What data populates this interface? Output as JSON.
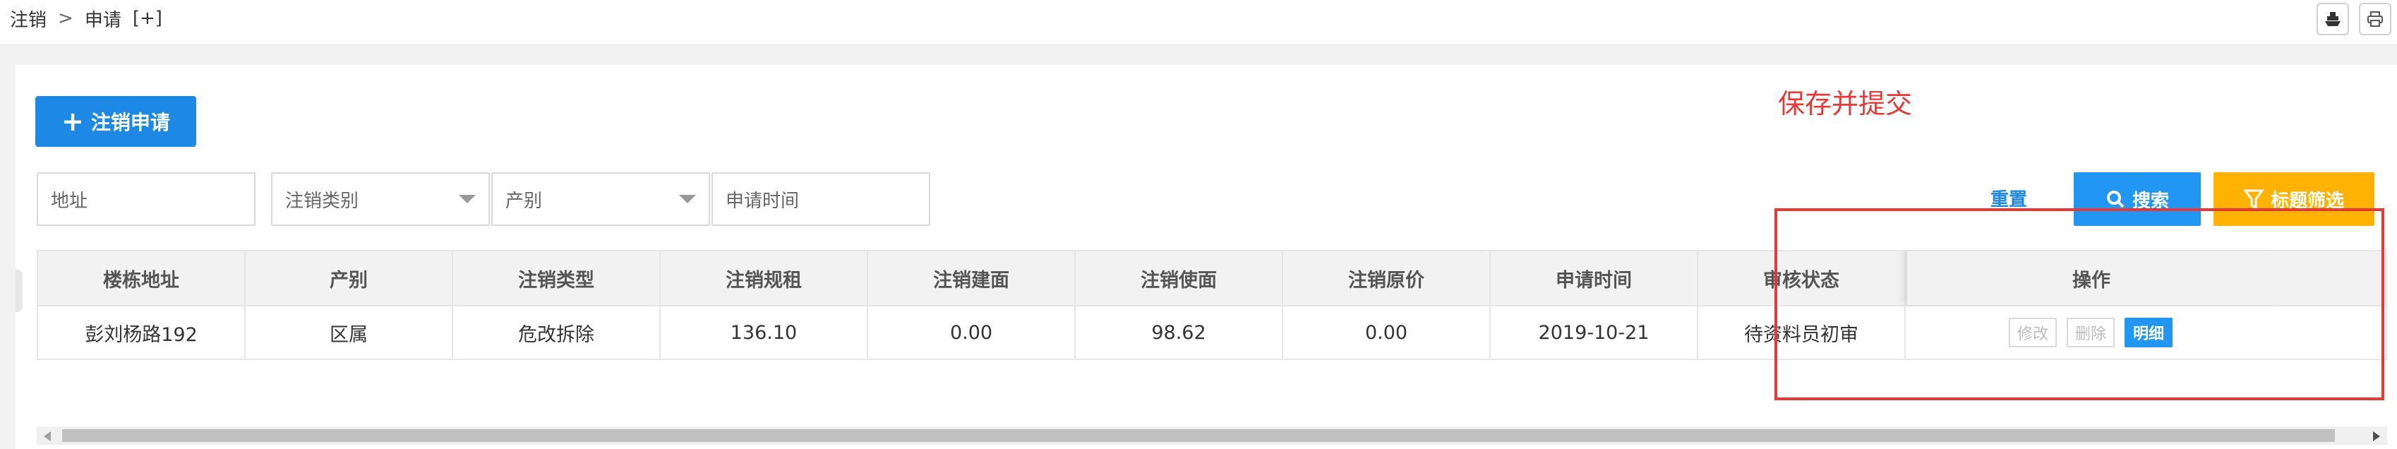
{
  "breadcrumb": {
    "item1": "注销",
    "separator": ">",
    "item2": "申请",
    "add": "[+]"
  },
  "top_icons": [
    "ship-icon",
    "print-icon"
  ],
  "toolbar": {
    "add_label": "注销申请"
  },
  "filters": {
    "address_placeholder": "地址",
    "category_placeholder": "注销类别",
    "property_placeholder": "产别",
    "date_placeholder": "申请时间"
  },
  "annotation": "保存并提交",
  "actions": {
    "reset": "重置",
    "search": "搜索",
    "advanced": "标题筛选"
  },
  "table": {
    "headers": [
      "楼栋地址",
      "产别",
      "注销类型",
      "注销规租",
      "注销建面",
      "注销使面",
      "注销原价",
      "申请时间",
      "审核状态",
      "操作"
    ],
    "rows": [
      {
        "address": "彭刘杨路192",
        "property": "区属",
        "type": "危改拆除",
        "rent": "136.10",
        "build_area": "0.00",
        "use_area": "98.62",
        "orig_price": "0.00",
        "date": "2019-10-21",
        "status": "待资料员初审",
        "ops": {
          "edit": "修改",
          "delete": "删除",
          "detail": "明细"
        }
      }
    ]
  },
  "colors": {
    "primary": "#2196f3",
    "warning": "#ffb300",
    "annotation": "#e53935"
  }
}
